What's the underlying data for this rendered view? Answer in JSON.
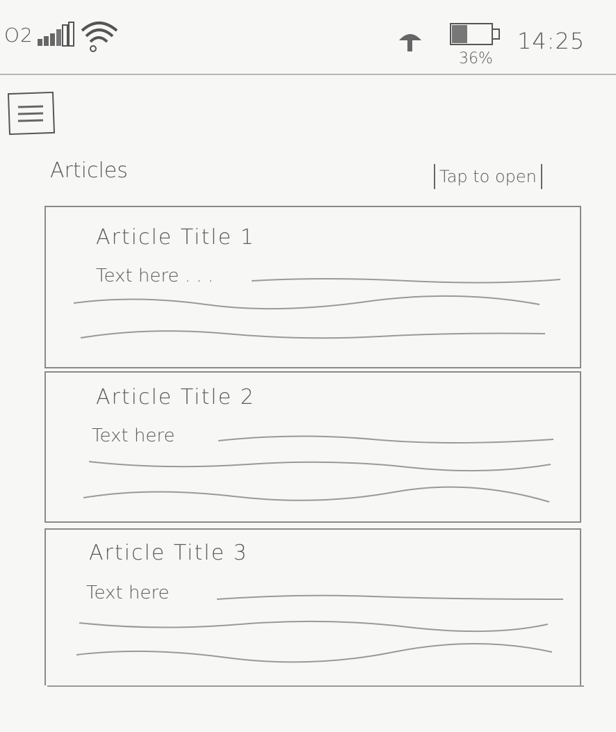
{
  "status_bar": {
    "carrier": "O2",
    "battery_percent": "36%",
    "time": "14:25",
    "icons": [
      "signal-bars-icon",
      "wifi-icon",
      "weather-icon",
      "battery-icon"
    ]
  },
  "menu": {
    "icon": "hamburger-menu-icon"
  },
  "articles": {
    "title": "Articles",
    "hint": "Tap to open",
    "items": [
      {
        "title": "Article Title 1",
        "text": "Text here . . ."
      },
      {
        "title": "Article Title 2",
        "text": "Text here"
      },
      {
        "title": "Article Title 3",
        "text": "Text here"
      }
    ]
  },
  "colors": {
    "background": "#f7f7f5",
    "pencil": "#5a5a5a",
    "border": "#8a8a8a"
  }
}
